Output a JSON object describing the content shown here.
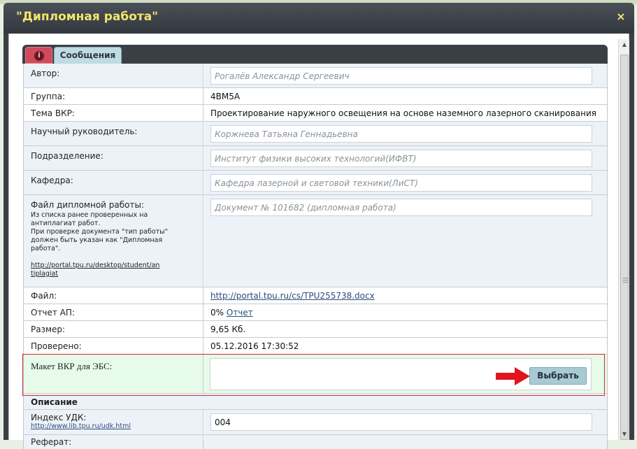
{
  "dialog": {
    "title": "\"Дипломная работа\"",
    "close_label": "×"
  },
  "tabs": {
    "info_icon": "i",
    "messages": "Сообщения"
  },
  "fields": {
    "author": {
      "label": "Автор:",
      "value": "Рогалёв Александр Сергеевич"
    },
    "group": {
      "label": "Группа:",
      "value": "4ВМ5А"
    },
    "topic": {
      "label": "Тема ВКР:",
      "value": "Проектирование наружного освещения на основе наземного лазерного сканирования"
    },
    "supervisor": {
      "label": "Научный руководитель:",
      "value": "Коржнева Татьяна Геннадьевна"
    },
    "department": {
      "label": "Подразделение:",
      "value": "Институт физики высоких технологий(ИФВТ)"
    },
    "chair": {
      "label": "Кафедра:",
      "value": "Кафедра лазерной и световой техники(ЛиСТ)"
    },
    "thesis_file": {
      "label": "Файл дипломной работы:",
      "note1": "Из списка ранее проверенных на антиплагиат работ.",
      "note2": "При проверке документа \"тип работы\" должен быть указан как \"Дипломная работа\".",
      "link": "http://portal.tpu.ru/desktop/student/antiplagiat",
      "value": "Документ № 101682 (дипломная работа)"
    },
    "file": {
      "label": "Файл:",
      "value": "http://portal.tpu.ru/cs/TPU255738.docx"
    },
    "ap_report": {
      "label": "Отчет АП:",
      "value": "0%",
      "link": "Отчет"
    },
    "size": {
      "label": "Размер:",
      "value": "9,65 Кб."
    },
    "checked": {
      "label": "Проверено:",
      "value": "05.12.2016 17:30:52"
    },
    "ebs_layout": {
      "label": "Макет ВКР для ЭБС:",
      "button": "Выбрать"
    }
  },
  "description": {
    "section_title": "Описание",
    "udk_label": "Индекс УДК:",
    "udk_link": "http://www.lib.tpu.ru/udk.html",
    "udk_value": "004",
    "next_label": "Реферат:"
  },
  "colors": {
    "title_text": "#f2e66b",
    "highlight_row": "#e6fbe9",
    "highlight_border": "#d22a2a",
    "arrow": "#e0141e",
    "button": "#a8cad3"
  }
}
